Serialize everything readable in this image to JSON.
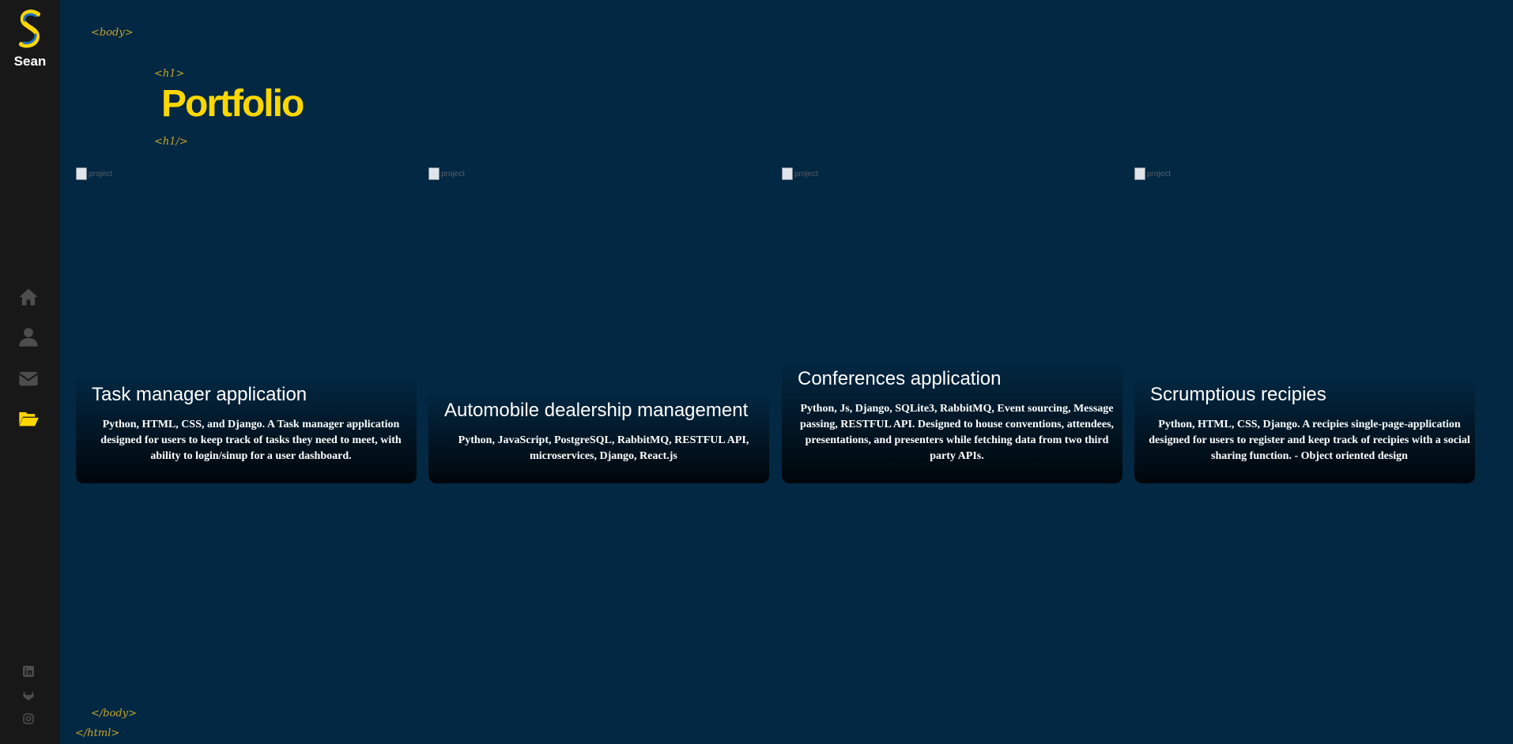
{
  "sidebar": {
    "logo_letter": "S",
    "name": "Sean",
    "nav": [
      {
        "icon": "home-icon",
        "active": false
      },
      {
        "icon": "user-icon",
        "active": false
      },
      {
        "icon": "envelope-icon",
        "active": false
      },
      {
        "icon": "folder-open-icon",
        "active": true
      }
    ],
    "social": [
      "linkedin-icon",
      "gitlab-icon",
      "instagram-icon"
    ]
  },
  "tags": {
    "body_open": "<body>",
    "h1_open": "<h1>",
    "h1_close": "<h1/>",
    "body_close": "</body>",
    "html_close": "</html>"
  },
  "page": {
    "title": "Portfolio"
  },
  "projects": [
    {
      "img_alt": "project",
      "title": "Task manager application",
      "description": "Python, HTML, CSS, and Django. A Task manager application designed for users to keep track of tasks they need to meet, with ability to login/sinup for a user dashboard."
    },
    {
      "img_alt": "project",
      "title": "Automobile dealership management",
      "description": "Python, JavaScript, PostgreSQL, RabbitMQ, RESTFUL API, microservices, Django, React.js"
    },
    {
      "img_alt": "project",
      "title": "Conferences application",
      "description": "Python, Js, Django, SQLite3, RabbitMQ, Event sourcing, Message passing, RESTFUL API. Designed to house conventions, attendees, presentations, and presenters while fetching data from two third party APIs."
    },
    {
      "img_alt": "project",
      "title": "Scrumptious recipies",
      "description": "Python, HTML, CSS, Django. A recipies single-page-application designed for users to register and keep track of recipies with a social sharing function. - Object oriented design"
    }
  ],
  "colors": {
    "background": "#022843",
    "sidebar": "#181818",
    "accent": "#ffd700",
    "tag": "#c7a52a",
    "icon": "#4d4d4e"
  }
}
